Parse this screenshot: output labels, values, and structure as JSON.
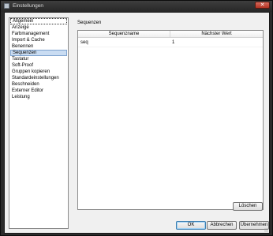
{
  "window": {
    "title": "Einstellungen",
    "close_label": "✕"
  },
  "sidebar": {
    "items": [
      {
        "label": "Allgemein"
      },
      {
        "label": "Anzeige"
      },
      {
        "label": "Farbmanagement"
      },
      {
        "label": "Import & Cache"
      },
      {
        "label": "Benennen"
      },
      {
        "label": "Sequenzen"
      },
      {
        "label": "Tastatur"
      },
      {
        "label": "Soft-Proof"
      },
      {
        "label": "Gruppen kopieren"
      },
      {
        "label": "Standardeinstellungen"
      },
      {
        "label": "Beschneiden"
      },
      {
        "label": "Externer Editor"
      },
      {
        "label": "Leistung"
      }
    ],
    "selected": "Sequenzen"
  },
  "main": {
    "section_title": "Sequenzen",
    "table": {
      "columns": [
        "Sequenzname",
        "Nächster Wert"
      ],
      "rows": [
        {
          "name": "seq",
          "next_value": "1"
        }
      ]
    },
    "delete_label": "Löschen"
  },
  "footer": {
    "ok_label": "OK",
    "cancel_label": "Abbrechen",
    "apply_label": "Übernehmen"
  }
}
